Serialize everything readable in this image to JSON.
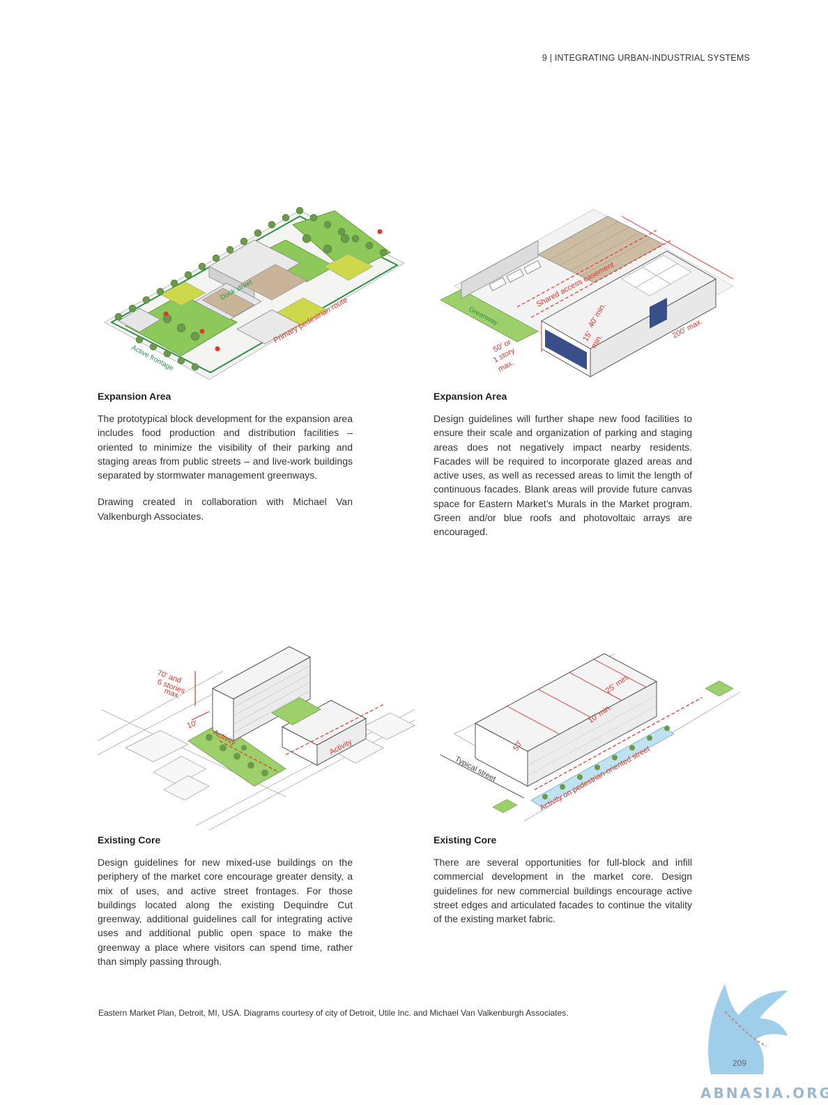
{
  "running_head": "9 | INTEGRATING URBAN-INDUSTRIAL SYSTEMS",
  "figures": {
    "top_left": {
      "labels": {
        "active_frontage": "Active frontage",
        "primary_pedestrian_route": "Primary pedestrian route",
        "dock_street": "Dock street"
      }
    },
    "top_right": {
      "labels": {
        "shared_access_easement": "Shared access easement",
        "greenway": "Greenway",
        "height_50": "50' or",
        "height_story": "1 story",
        "height_max": "max.",
        "min_40": "40' min.",
        "min_15": "15'",
        "min_15b": "min.",
        "max_200": "200' max."
      }
    },
    "bottom_left": {
      "labels": {
        "height_70": "70' and",
        "stories": "6 stories",
        "max": "max.",
        "dim_10": "10'",
        "activity": "Activity",
        "activity2": "Activity"
      }
    },
    "bottom_right": {
      "labels": {
        "typical_street": "Typical street",
        "activity_street": "Activity on pedestrian-oriented street",
        "min_25": "25' min.",
        "min_10": "10' min.",
        "dim_50": "50'"
      }
    }
  },
  "captions": {
    "expansion_left": {
      "heading": "Expansion Area",
      "p1": "The prototypical block development for the expansion area includes food production and distribution facilities – oriented to minimize the visibility of their parking and staging areas from public streets – and live-work buildings separated by stormwater management greenways.",
      "p2": "Drawing created in collaboration with Michael Van Valkenburgh Associates."
    },
    "expansion_right": {
      "heading": "Expansion Area",
      "p1": "Design guidelines will further shape new food facilities to ensure their scale and organization of parking and staging areas does not negatively impact nearby residents. Facades will be required to incorporate glazed areas and active uses, as well as recessed areas to limit the length of continuous facades. Blank areas will provide future canvas space for Eastern Market’s Murals in the Market program. Green and/or blue roofs and photovoltaic arrays are encouraged."
    },
    "core_left": {
      "heading": "Existing Core",
      "p1": "Design guidelines for new mixed-use buildings on the periphery of the market core encourage greater density, a mix of uses, and active street frontages. For those buildings located along the existing Dequindre Cut greenway, additional guidelines call for integrating active uses and additional public open space to make the greenway a place where visitors can spend time, rather than simply passing through."
    },
    "core_right": {
      "heading": "Existing Core",
      "p1": "There are several opportunities for full-block and infill commercial development in the market core. Design guidelines for new commercial buildings encourage active street edges and articulated facades to continue the vitality of the existing market fabric."
    }
  },
  "credit": "Eastern Market Plan, Detroit, MI, USA. Diagrams courtesy of city of Detroit, Utile Inc. and Michael Van Valkenburgh Associates.",
  "page_number": "209",
  "watermark": "ABNASIA.ORG",
  "colors": {
    "dimension_red": "#e2362b",
    "green_space": "#7cc04a",
    "lawn": "#c9d84a",
    "roof_grey": "#e8e8e8",
    "parking_tan": "#c9b49a"
  }
}
